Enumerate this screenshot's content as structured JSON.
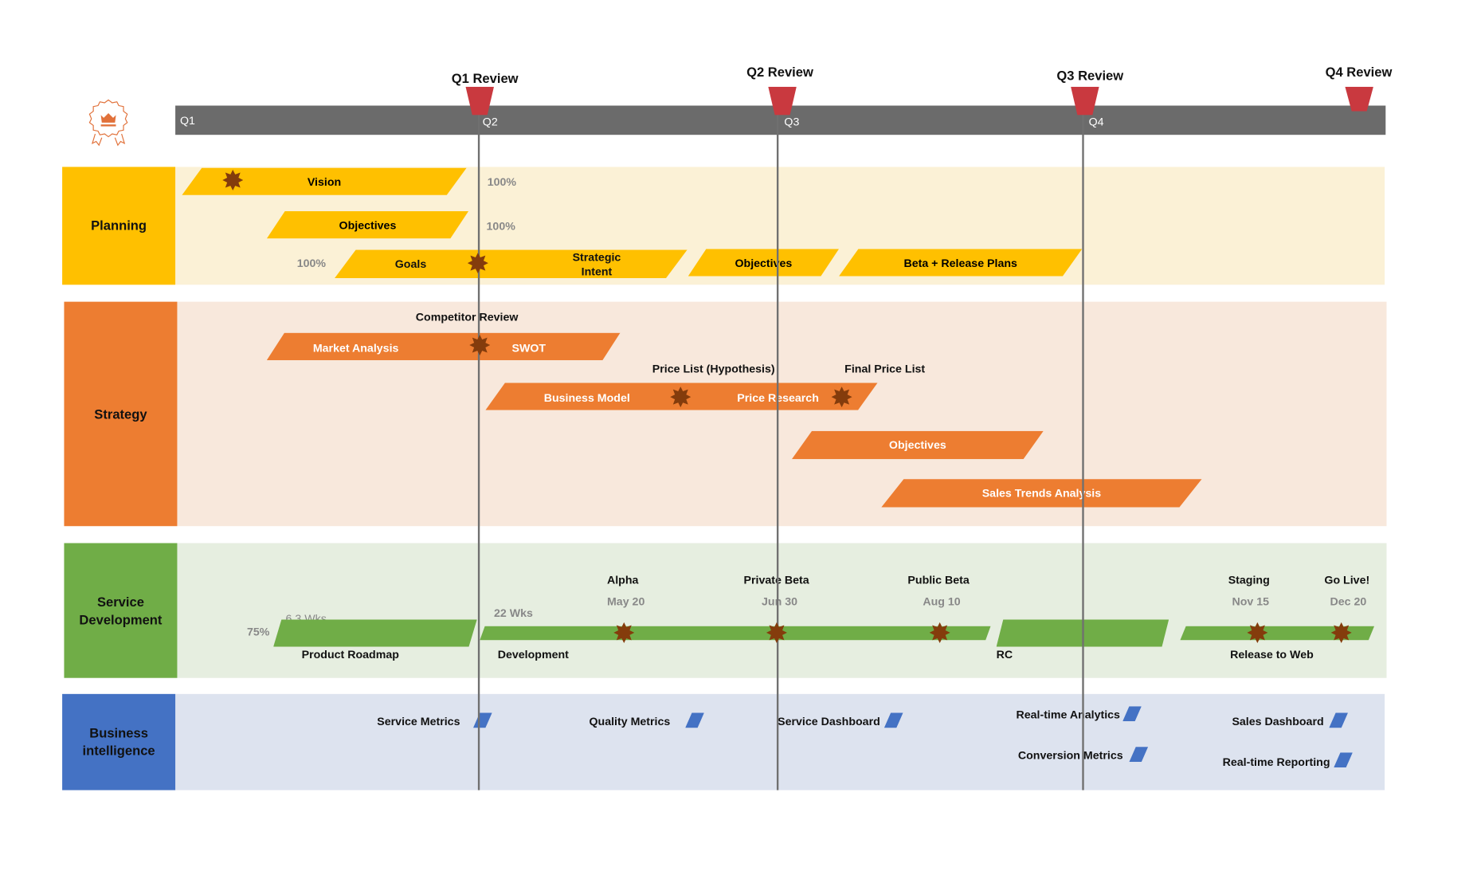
{
  "logo": {
    "icon": "award-crown-icon",
    "color": "#E1713A"
  },
  "timeline": {
    "quarters": [
      "Q1",
      "Q2",
      "Q3",
      "Q4"
    ],
    "bar_color": "#6B6B6B",
    "reviews": [
      {
        "label": "Q1 Review",
        "quarter": "Q2"
      },
      {
        "label": "Q2 Review",
        "quarter": "Q3"
      },
      {
        "label": "Q3 Review",
        "quarter": "Q4"
      },
      {
        "label": "Q4 Review",
        "quarter": "end"
      }
    ],
    "review_color": "#C9393F"
  },
  "lanes": [
    {
      "name": "Planning",
      "color": "#FFC000",
      "bg": "#FBF1D6",
      "tasks": [
        {
          "label": "Vision",
          "progress": "100%"
        },
        {
          "label": "Objectives",
          "progress": "100%"
        },
        {
          "label": "Goals",
          "progress": "100%"
        },
        {
          "label": "Strategic Intent"
        },
        {
          "label": "Objectives"
        },
        {
          "label": "Beta + Release Plans"
        }
      ]
    },
    {
      "name": "Strategy",
      "color": "#ED7D31",
      "bg": "#F8E8DC",
      "tasks": [
        {
          "label": "Market Analysis"
        },
        {
          "label": "SWOT"
        },
        {
          "label": "Business Model"
        },
        {
          "label": "Price Research"
        },
        {
          "label": "Objectives"
        },
        {
          "label": "Sales Trends Analysis"
        }
      ],
      "milestones": [
        "Competitor Review",
        "Price List (Hypothesis)",
        "Final Price List"
      ]
    },
    {
      "name": "Service Development",
      "name_lines": [
        "Service",
        "Development"
      ],
      "color": "#70AD47",
      "bg": "#E6EEE0",
      "tasks": [
        {
          "label": "Product Roadmap",
          "progress": "75%",
          "duration": "6.3 Wks"
        },
        {
          "label": "Development",
          "duration": "22 Wks"
        },
        {
          "label": "RC"
        },
        {
          "label": "Release to Web"
        }
      ],
      "milestones": [
        {
          "label": "Alpha",
          "date": "May 20"
        },
        {
          "label": "Private Beta",
          "date": "Jun 30"
        },
        {
          "label": "Public Beta",
          "date": "Aug 10"
        },
        {
          "label": "Staging",
          "date": "Nov 15"
        },
        {
          "label": "Go Live!",
          "date": "Dec 20"
        }
      ]
    },
    {
      "name": "Business intelligence",
      "name_lines": [
        "Business",
        "intelligence"
      ],
      "color": "#4472C4",
      "bg": "#DDE3EF",
      "items": [
        "Service Metrics",
        "Quality Metrics",
        "Service Dashboard",
        "Real-time Analytics",
        "Conversion Metrics",
        "Sales Dashboard",
        "Real-time Reporting"
      ]
    }
  ]
}
